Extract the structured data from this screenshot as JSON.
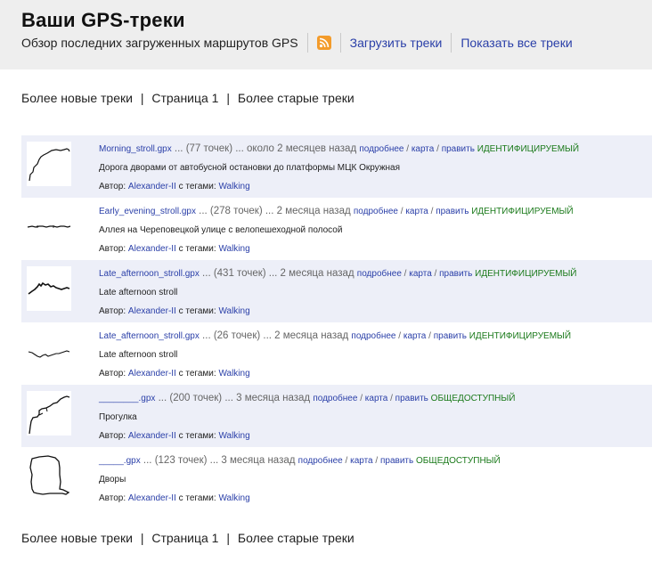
{
  "header": {
    "title": "Ваши GPS-треки",
    "subtitle": "Обзор последних загруженных маршрутов GPS",
    "rss_icon": "rss-feed-icon",
    "upload_link": "Загрузить треки",
    "show_all_link": "Показать все треки"
  },
  "pagination": {
    "newer": "Более новые треки",
    "sep": "|",
    "page": "Страница 1",
    "older": "Более старые треки"
  },
  "tracks": [
    {
      "filename": "Morning_stroll.gpx",
      "meta": " ... (77 точек) ... около 2 месяцев назад ",
      "details": "подробнее",
      "map": "карта",
      "edit": "править",
      "visibility": "ИДЕНТИФИЦИРУЕМЫЙ",
      "description": "Дорога дворами от автобусной остановки до платформы МЦК Окружная",
      "author_prefix": "Автор: ",
      "author": "Alexander-II",
      "tags_prefix": " с тегами: ",
      "tag": "Walking"
    },
    {
      "filename": "Early_evening_stroll.gpx",
      "meta": " ... (278 точек) ... 2 месяца назад ",
      "details": "подробнее",
      "map": "карта",
      "edit": "править",
      "visibility": "ИДЕНТИФИЦИРУЕМЫЙ",
      "description": "Аллея на Череповецкой улице с велопешеходной полосой",
      "author_prefix": "Автор: ",
      "author": "Alexander-II",
      "tags_prefix": " с тегами: ",
      "tag": "Walking"
    },
    {
      "filename": "Late_afternoon_stroll.gpx",
      "meta": " ... (431 точек) ... 2 месяца назад ",
      "details": "подробнее",
      "map": "карта",
      "edit": "править",
      "visibility": "ИДЕНТИФИЦИРУЕМЫЙ",
      "description": "Late afternoon stroll",
      "author_prefix": "Автор: ",
      "author": "Alexander-II",
      "tags_prefix": " с тегами: ",
      "tag": "Walking"
    },
    {
      "filename": "Late_afternoon_stroll.gpx",
      "meta": " ... (26 точек) ... 2 месяца назад ",
      "details": "подробнее",
      "map": "карта",
      "edit": "править",
      "visibility": "ИДЕНТИФИЦИРУЕМЫЙ",
      "description": "Late afternoon stroll",
      "author_prefix": "Автор: ",
      "author": "Alexander-II",
      "tags_prefix": " с тегами: ",
      "tag": "Walking"
    },
    {
      "filename": "________.gpx",
      "meta": " ... (200 точек) ... 3 месяца назад ",
      "details": "подробнее",
      "map": "карта",
      "edit": "править",
      "visibility": "ОБЩЕДОСТУПНЫЙ",
      "description": "Прогулка",
      "author_prefix": "Автор: ",
      "author": "Alexander-II",
      "tags_prefix": " с тегами: ",
      "tag": "Walking"
    },
    {
      "filename": "_____.gpx",
      "meta": " ... (123 точек) ... 3 месяца назад ",
      "details": "подробнее",
      "map": "карта",
      "edit": "править",
      "visibility": "ОБЩЕДОСТУПНЫЙ",
      "description": "Дворы",
      "author_prefix": "Автор: ",
      "author": "Alexander-II",
      "tags_prefix": " с тегами: ",
      "tag": "Walking"
    }
  ],
  "colors": {
    "link": "#2a3fa8",
    "visibility": "#1b7a1b",
    "row_shade": "#edeff8",
    "header_bg": "#eeeeee",
    "rss": "#f39b2b"
  }
}
